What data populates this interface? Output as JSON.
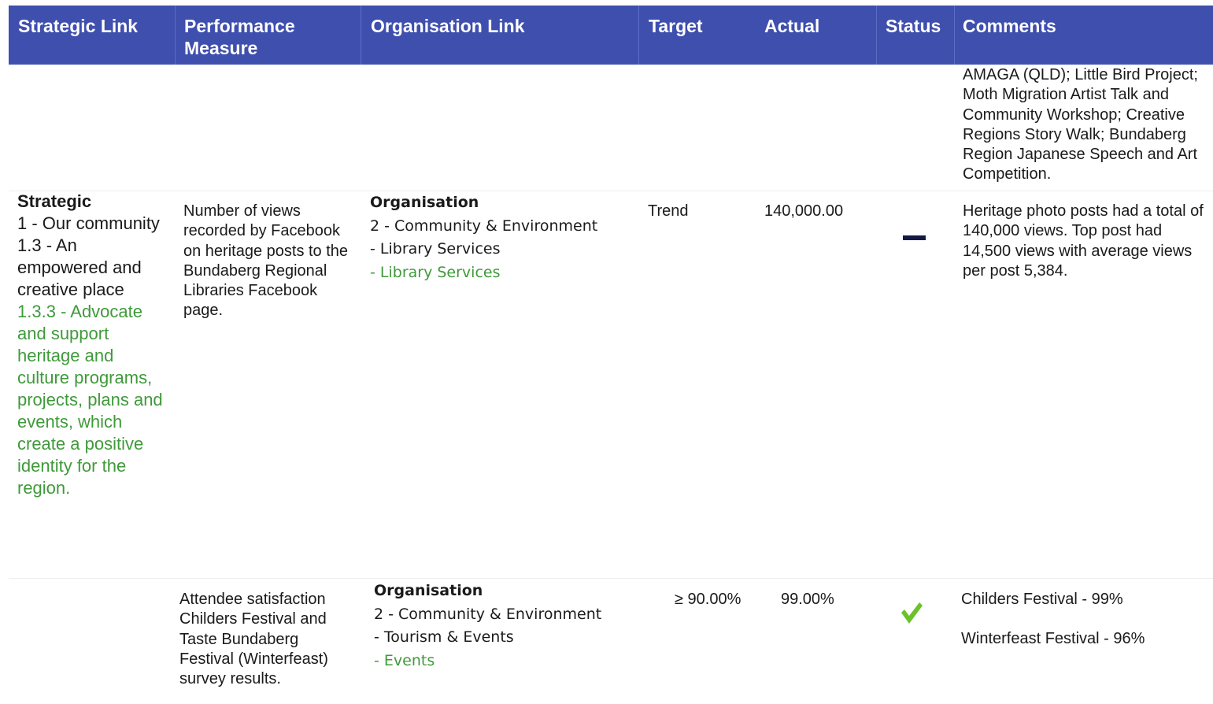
{
  "header": {
    "strategic_link": "Strategic Link",
    "performance_measure": "Performance Measure",
    "organisation_link": "Organisation Link",
    "target": "Target",
    "actual": "Actual",
    "status": "Status",
    "comments": "Comments"
  },
  "row_continued": {
    "comments": "AMAGA (QLD); Little Bird Project; Moth Migration Artist Talk and Community Workshop; Creative Regions Story Walk; Bundaberg Region Japanese Speech and Art Competition."
  },
  "row1": {
    "strategic": {
      "heading": "Strategic",
      "line1": "1 - Our community",
      "line2": "1.3 - An empowered and creative place",
      "line3": "1.3.3 - Advocate and support heritage and culture programs, projects, plans and events, which create a positive identity for the region."
    },
    "performance_measure": "Number of views recorded by Facebook on heritage posts to the Bundaberg Regional Libraries Facebook page.",
    "organisation": {
      "heading": "Organisation",
      "line1": "2 - Community & Environment",
      "line2": "- Library Services",
      "line3": "- Library Services"
    },
    "target": "Trend",
    "actual": "140,000.00",
    "status": "neutral-dash",
    "comments": "Heritage photo posts had a total of 140,000 views. Top post had 14,500 views with average views per post 5,384."
  },
  "row2": {
    "performance_measure": "Attendee satisfaction Childers Festival and Taste Bundaberg Festival (Winterfeast) survey results.",
    "organisation": {
      "heading": "Organisation",
      "line1": "2 - Community & Environment",
      "line2": "- Tourism & Events",
      "line3": "- Events"
    },
    "target": "≥ 90.00%",
    "actual": "99.00%",
    "status": "check-mark",
    "comments_line1": "Childers Festival - 99%",
    "comments_line2": "Winterfeast Festival - 96%"
  },
  "colors": {
    "header_bg": "#3f4fae",
    "green_text": "#3f9a3a",
    "check_green": "#6cc22a",
    "dash_navy": "#121a44"
  }
}
